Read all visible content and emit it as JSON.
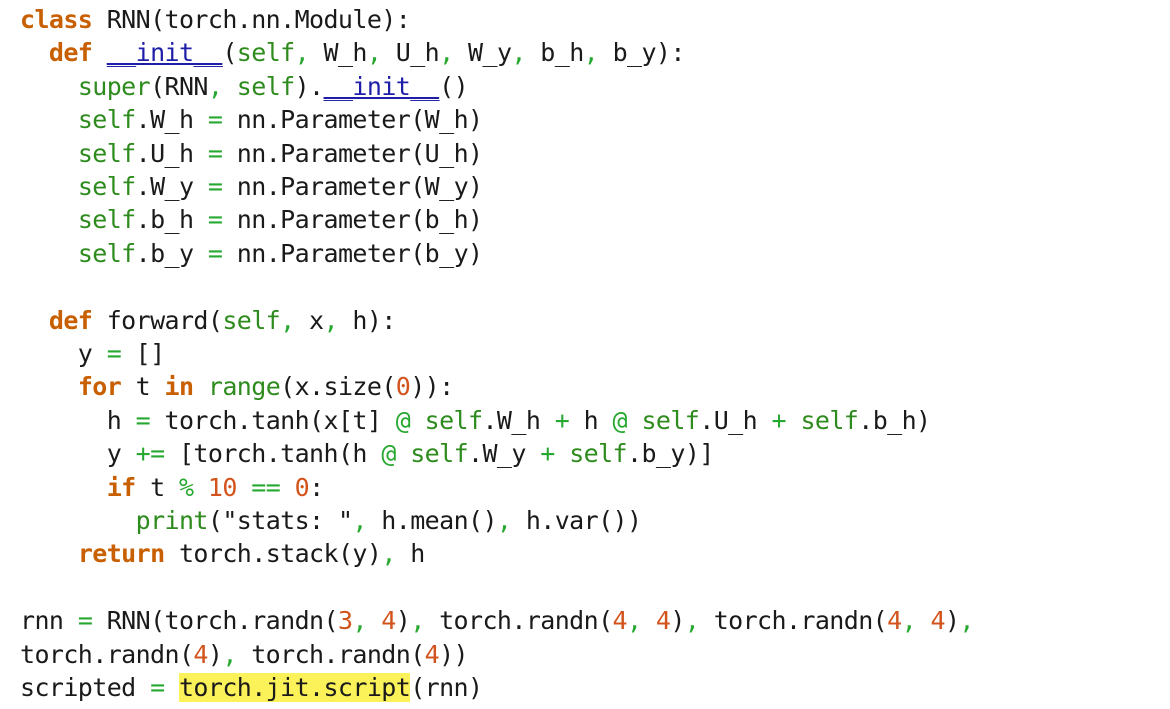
{
  "colors": {
    "keyword": "#c85f00",
    "self": "#2e8b1e",
    "dunder": "#1e1ea8",
    "operator": "#27a830",
    "number": "#d2541c",
    "highlight": "#fbf25a",
    "text": "#1a1a1a"
  },
  "code_lines": [
    "class RNN(torch.nn.Module):",
    "  def __init__(self, W_h, U_h, W_y, b_h, b_y):",
    "    super(RNN, self).__init__()",
    "    self.W_h = nn.Parameter(W_h)",
    "    self.U_h = nn.Parameter(U_h)",
    "    self.W_y = nn.Parameter(W_y)",
    "    self.b_h = nn.Parameter(b_h)",
    "    self.b_y = nn.Parameter(b_y)",
    "",
    "  def forward(self, x, h):",
    "    y = []",
    "    for t in range(x.size(0)):",
    "      h = torch.tanh(x[t] @ self.W_h + h @ self.U_h + self.b_h)",
    "      y += [torch.tanh(h @ self.W_y + self.b_y)]",
    "      if t % 10 == 0:",
    "        print(\"stats: \", h.mean(), h.var())",
    "    return torch.stack(y), h",
    "",
    "rnn = RNN(torch.randn(3, 4), torch.randn(4, 4), torch.randn(4, 4),",
    "torch.randn(4), torch.randn(4))",
    "scripted = torch.jit.script(rnn)"
  ],
  "highlighted_text": "torch.jit.script"
}
